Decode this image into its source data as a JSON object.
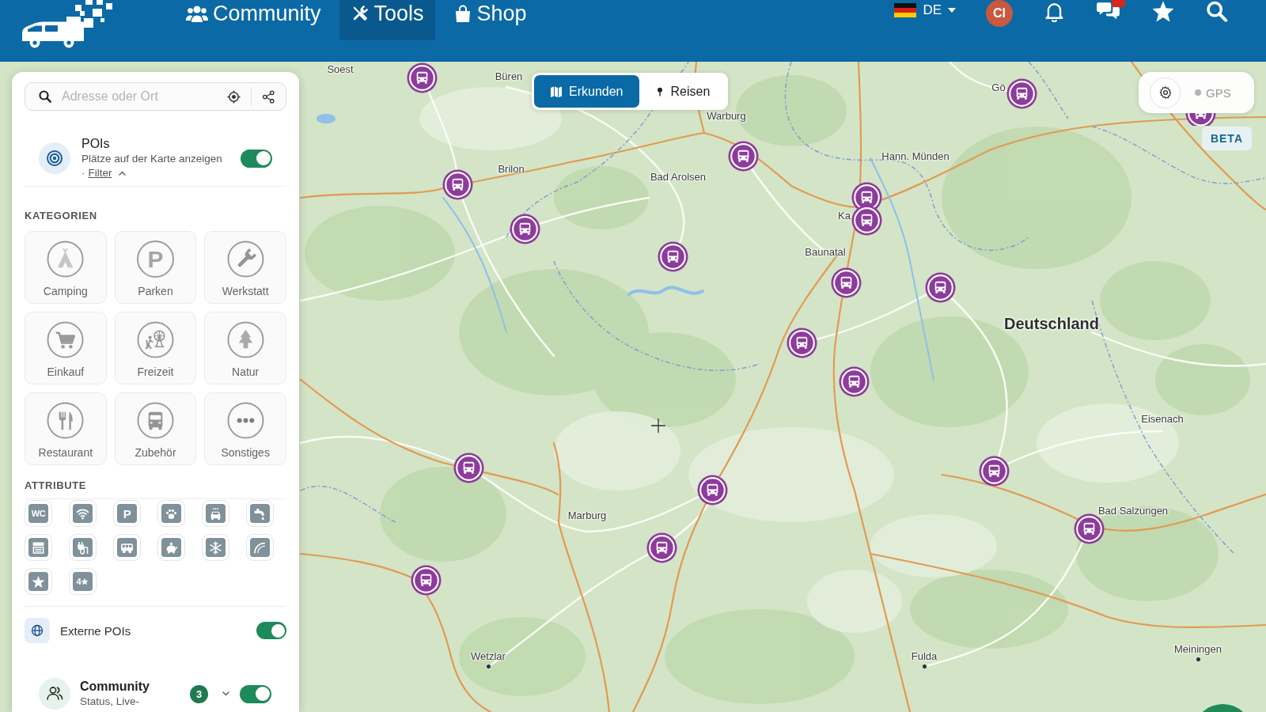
{
  "header": {
    "nav": [
      {
        "label": "Community",
        "kind": "community",
        "selected": false
      },
      {
        "label": "Tools",
        "kind": "tools",
        "selected": true
      },
      {
        "label": "Shop",
        "kind": "shop",
        "selected": false
      }
    ],
    "language": "DE",
    "avatar_initials": "CI"
  },
  "sidebar": {
    "search": {
      "placeholder": "Adresse oder Ort"
    },
    "pois": {
      "title": "POIs",
      "subtitle": "Plätze auf der Karte anzeigen",
      "filter_prefix": "·",
      "filter_link": "Filter",
      "filter_expanded": true,
      "on": true
    },
    "categories_heading": "KATEGORIEN",
    "parking_sign": "P",
    "categories": [
      {
        "label": "Camping",
        "kind": "camping"
      },
      {
        "label": "Parken",
        "kind": "parking"
      },
      {
        "label": "Werkstatt",
        "kind": "workshop"
      },
      {
        "label": "Einkauf",
        "kind": "shopping"
      },
      {
        "label": "Freizeit",
        "kind": "leisure"
      },
      {
        "label": "Natur",
        "kind": "nature"
      },
      {
        "label": "Restaurant",
        "kind": "restaurant"
      },
      {
        "label": "Zubehör",
        "kind": "accessories"
      },
      {
        "label": "Sonstiges",
        "kind": "other"
      }
    ],
    "attributes_heading": "ATTRIBUTE",
    "attributes": [
      {
        "kind": "toilet",
        "glyph": "WC"
      },
      {
        "kind": "wifi"
      },
      {
        "kind": "parking",
        "glyph": "P"
      },
      {
        "kind": "pets"
      },
      {
        "kind": "car"
      },
      {
        "kind": "water"
      },
      {
        "kind": "cabinet"
      },
      {
        "kind": "power"
      },
      {
        "kind": "bus"
      },
      {
        "kind": "budget"
      },
      {
        "kind": "winter"
      },
      {
        "kind": "arc"
      },
      {
        "kind": "star"
      },
      {
        "kind": "rating",
        "glyph": "4"
      }
    ],
    "external_pois": {
      "label": "Externe POIs",
      "on": true
    },
    "community": {
      "title": "Community",
      "subtitle": "Status, Live-",
      "count": "3",
      "expanded": false,
      "on": true
    }
  },
  "map": {
    "mode_tabs": [
      {
        "label": "Erkunden",
        "kind": "explore",
        "selected": true
      },
      {
        "label": "Reisen",
        "kind": "travel",
        "selected": false
      }
    ],
    "gps": {
      "label": "GPS",
      "on": false
    },
    "badge": "BETA",
    "labels": [
      {
        "text": "Soest",
        "kind": "town",
        "dot": false
      },
      {
        "text": "Büren",
        "kind": "town",
        "dot": false
      },
      {
        "text": "Gö",
        "kind": "town",
        "dot": false
      },
      {
        "text": "Warburg",
        "kind": "town",
        "dot": false
      },
      {
        "text": "Brilon",
        "kind": "town",
        "dot": false
      },
      {
        "text": "Bad Arolsen",
        "kind": "town",
        "dot": false
      },
      {
        "text": "Hann. Münden",
        "kind": "town",
        "dot": false
      },
      {
        "text": "Ka",
        "kind": "town",
        "dot": false
      },
      {
        "text": "Baunatal",
        "kind": "town",
        "dot": false
      },
      {
        "text": "Deutschland",
        "kind": "country",
        "dot": false
      },
      {
        "text": "Eisenach",
        "kind": "town",
        "dot": false
      },
      {
        "text": "Marburg",
        "kind": "town",
        "dot": false
      },
      {
        "text": "Bad Salzungen",
        "kind": "town",
        "dot": false
      },
      {
        "text": "Wetzlar",
        "kind": "town",
        "dot": true
      },
      {
        "text": "Fulda",
        "kind": "town",
        "dot": true
      },
      {
        "text": "Meiningen",
        "kind": "town",
        "dot": true
      }
    ]
  }
}
